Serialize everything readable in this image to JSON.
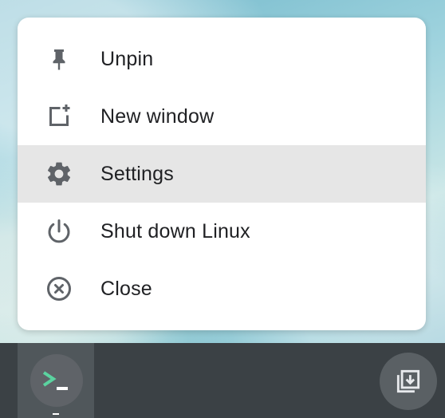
{
  "menu": {
    "items": [
      {
        "label": "Unpin",
        "icon": "pin-icon"
      },
      {
        "label": "New window",
        "icon": "new-window-icon"
      },
      {
        "label": "Settings",
        "icon": "gear-icon",
        "highlighted": true
      },
      {
        "label": "Shut down Linux",
        "icon": "power-icon"
      },
      {
        "label": "Close",
        "icon": "close-circle-icon"
      }
    ]
  },
  "shelf": {
    "apps": [
      {
        "icon": "terminal-icon",
        "prompt": ">_"
      }
    ],
    "tray": {
      "icon": "holding-space-icon"
    }
  },
  "colors": {
    "menu_bg": "#ffffff",
    "highlight_bg": "#e6e6e6",
    "icon": "#5f6368",
    "text": "#202124",
    "shelf_bg": "#3b4145",
    "terminal_prompt": "#5bd3a0"
  }
}
